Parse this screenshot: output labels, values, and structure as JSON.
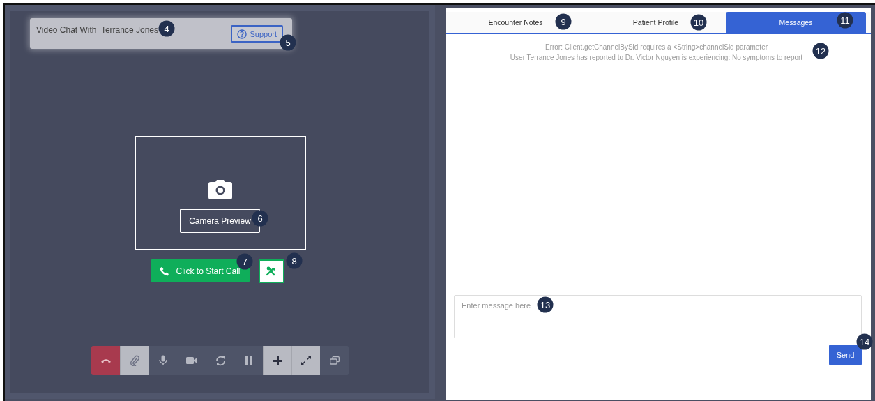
{
  "video_chat": {
    "title": "Video Chat With  Terrance Jones",
    "support_button": "Support",
    "camera_preview_button": "Camera Preview",
    "start_call_button": "Click to Start Call",
    "controls": [
      {
        "kind": "hangup",
        "on": false
      },
      {
        "kind": "attach",
        "on": true
      },
      {
        "kind": "mic",
        "on": false
      },
      {
        "kind": "video",
        "on": false
      },
      {
        "kind": "switch-camera",
        "on": false
      },
      {
        "kind": "pause",
        "on": false
      },
      {
        "kind": "add",
        "on": true
      },
      {
        "kind": "fullscreen",
        "on": true
      },
      {
        "kind": "popout",
        "on": false
      }
    ]
  },
  "tabs": [
    {
      "label": "Encounter Notes",
      "selected": false
    },
    {
      "label": "Patient Profile",
      "selected": false
    },
    {
      "label": "Messages",
      "selected": true
    }
  ],
  "messages": [
    "Error: Client.getChannelBySid requires a <String>channelSid parameter",
    "User Terrance Jones has reported to Dr. Victor Nguyen is experiencing: No symptoms to report"
  ],
  "message_input": {
    "placeholder": "Enter message here"
  },
  "send_button": "Send",
  "callouts": [
    "4",
    "5",
    "6",
    "7",
    "8",
    "9",
    "10",
    "11",
    "12",
    "13",
    "14"
  ]
}
